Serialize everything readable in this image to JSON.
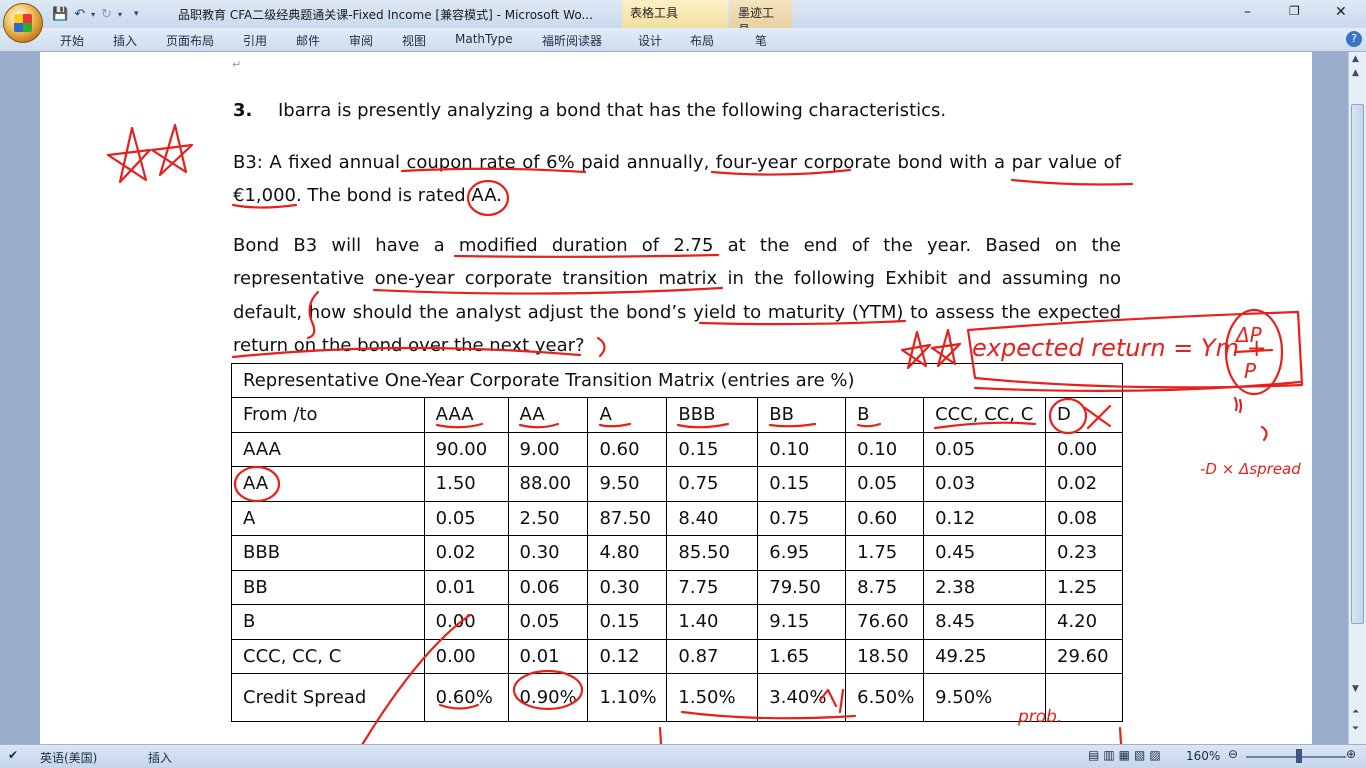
{
  "app": {
    "title": "品职教育 CFA二级经典题通关课-Fixed Income [兼容模式] - Microsoft Wo...",
    "contextual_tabs": [
      "表格工具",
      "墨迹工具"
    ],
    "window_buttons": {
      "minimize": "–",
      "restore": "❐",
      "close": "✕"
    }
  },
  "ribbon": {
    "tabs": [
      "开始",
      "插入",
      "页面布局",
      "引用",
      "邮件",
      "审阅",
      "视图",
      "MathType",
      "福昕阅读器",
      "设计",
      "布局",
      "笔"
    ]
  },
  "document": {
    "q_number": "3.",
    "q_text": "Ibarra is presently analyzing a bond that has the following characteristics.",
    "p1": "B3: A fixed annual coupon rate of 6% paid annually, four-year corporate bond with a par value of",
    "p1b": "€1,000. The bond is rated AA.",
    "p2a": "Bond B3 will have a modified duration of 2.75 at the end of the year. Based on the",
    "p2b": "representative one-year corporate transition matrix in the following Exhibit and assuming no",
    "p2c": "default, how should the analyst adjust the bond’s yield to maturity (YTM) to assess the expected",
    "p2d": "return on the bond over the next year?"
  },
  "matrix": {
    "caption": "Representative One-Year Corporate Transition Matrix (entries are %)",
    "headers": [
      "From /to",
      "AAA",
      "AA",
      "A",
      "BBB",
      "BB",
      "B",
      "CCC, CC, C",
      "D"
    ],
    "rows": [
      [
        "AAA",
        "90.00",
        "9.00",
        "0.60",
        "0.15",
        "0.10",
        "0.10",
        "0.05",
        "0.00"
      ],
      [
        "AA",
        "1.50",
        "88.00",
        "9.50",
        "0.75",
        "0.15",
        "0.05",
        "0.03",
        "0.02"
      ],
      [
        "A",
        "0.05",
        "2.50",
        "87.50",
        "8.40",
        "0.75",
        "0.60",
        "0.12",
        "0.08"
      ],
      [
        "BBB",
        "0.02",
        "0.30",
        "4.80",
        "85.50",
        "6.95",
        "1.75",
        "0.45",
        "0.23"
      ],
      [
        "BB",
        "0.01",
        "0.06",
        "0.30",
        "7.75",
        "79.50",
        "8.75",
        "2.38",
        "1.25"
      ],
      [
        "B",
        "0.00",
        "0.05",
        "0.15",
        "1.40",
        "9.15",
        "76.60",
        "8.45",
        "4.20"
      ],
      [
        "CCC, CC, C",
        "0.00",
        "0.01",
        "0.12",
        "0.87",
        "1.65",
        "18.50",
        "49.25",
        "29.60"
      ],
      [
        "Credit Spread",
        "0.60%",
        "0.90%",
        "1.10%",
        "1.50%",
        "3.40%",
        "6.50%",
        "9.50%",
        ""
      ]
    ]
  },
  "ink_notes": {
    "formula_a": "expected return = Ym +",
    "formula_dp": "ΔP",
    "formula_p": "P",
    "side_note": "-D × Δspread",
    "prob": "prob."
  },
  "status": {
    "language": "英语(美国)",
    "mode": "插入",
    "zoom": "160%"
  },
  "colors": {
    "ink": "#e8201c",
    "ribbon": "#cfdcee"
  }
}
